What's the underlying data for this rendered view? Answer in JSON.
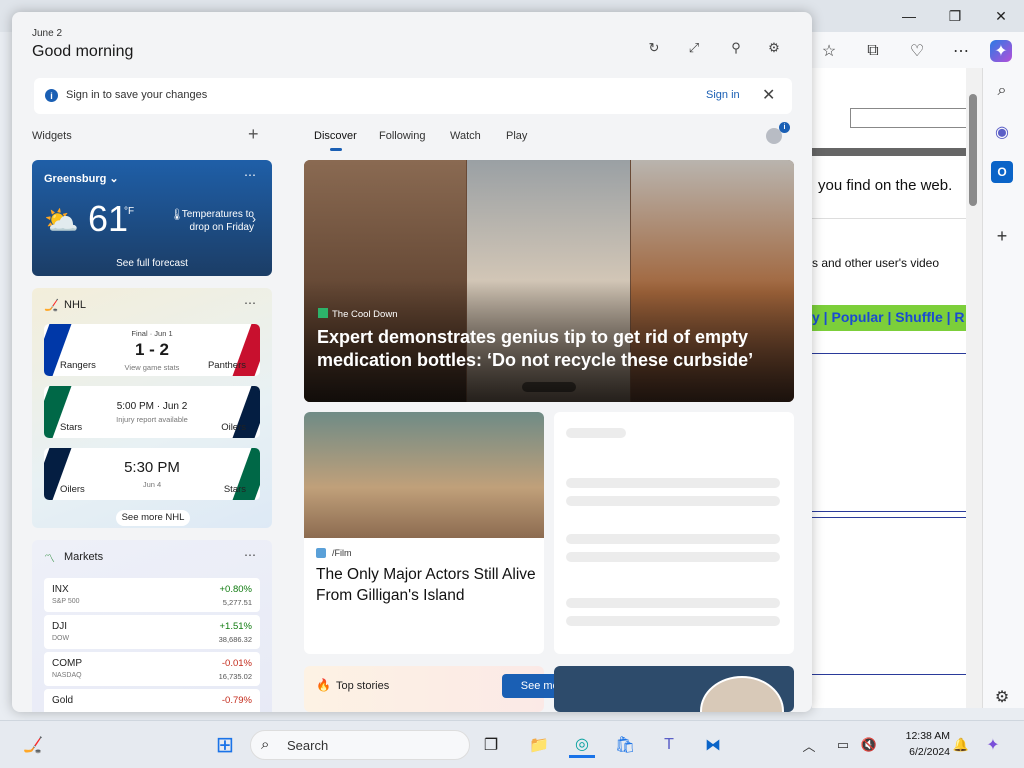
{
  "browser": {
    "window_controls": {
      "minimize": "—",
      "maximize": "❐",
      "close": "✕"
    },
    "toolbar_icons": [
      "favorites-icon",
      "collections-icon",
      "browser-essentials-icon",
      "more-icon",
      "copilot-icon"
    ],
    "sidebar_icons": [
      "search-icon",
      "copilot-sidebar-icon",
      "outlook-icon",
      "add-icon",
      "settings-icon"
    ],
    "page_text": [
      "you find on the web.",
      "s and other user's video",
      "y | Popular | Shuffle | R"
    ]
  },
  "widgets": {
    "date": "June 2",
    "greeting": "Good morning",
    "signin_bar": {
      "message": "Sign in to save your changes",
      "link": "Sign in"
    },
    "section_label": "Widgets",
    "add_symbol": "+",
    "tabs": [
      "Discover",
      "Following",
      "Watch",
      "Play"
    ],
    "weather": {
      "location": "Greensburg",
      "temp": "61",
      "unit": "°F",
      "note": "Temperatures to drop on Friday",
      "forecast_link": "See full forecast"
    },
    "nhl": {
      "title": "NHL",
      "games": [
        {
          "status": "Final · Jun 1",
          "score": "1 - 2",
          "sub": "View game stats",
          "home": "Rangers",
          "away": "Panthers",
          "home_color": "#0038a8",
          "away_color": "#c8102e"
        },
        {
          "status": "5:00 PM · Jun 2",
          "score": "",
          "sub": "Injury report available",
          "home": "Stars",
          "away": "Oilers",
          "home_color": "#006847",
          "away_color": "#041e42"
        },
        {
          "status": "",
          "score": "5:30 PM",
          "sub": "Jun 4",
          "home": "Oilers",
          "away": "Stars",
          "home_color": "#041e42",
          "away_color": "#006847"
        }
      ],
      "see_more": "See more NHL"
    },
    "markets": {
      "title": "Markets",
      "rows": [
        {
          "symbol": "INX",
          "name": "S&P 500",
          "change": "+0.80%",
          "value": "5,277.51",
          "up": true
        },
        {
          "symbol": "DJI",
          "name": "DOW",
          "change": "+1.51%",
          "value": "38,686.32",
          "up": true
        },
        {
          "symbol": "COMP",
          "name": "NASDAQ",
          "change": "-0.01%",
          "value": "16,735.02",
          "up": false
        },
        {
          "symbol": "Gold",
          "name": "",
          "change": "-0.79%",
          "value": "",
          "up": false
        }
      ]
    },
    "hero": {
      "source": "The Cool Down",
      "title": "Expert demonstrates genius tip to get rid of empty medication bottles: ‘Do not recycle these curbside’"
    },
    "card2": {
      "source": "/Film",
      "title": "The Only Major Actors Still Alive From Gilligan's Island"
    },
    "top_stories": {
      "title": "Top stories",
      "button": "See more"
    }
  },
  "taskbar": {
    "search_placeholder": "Search",
    "time": "12:38 AM",
    "date": "6/2/2024"
  }
}
